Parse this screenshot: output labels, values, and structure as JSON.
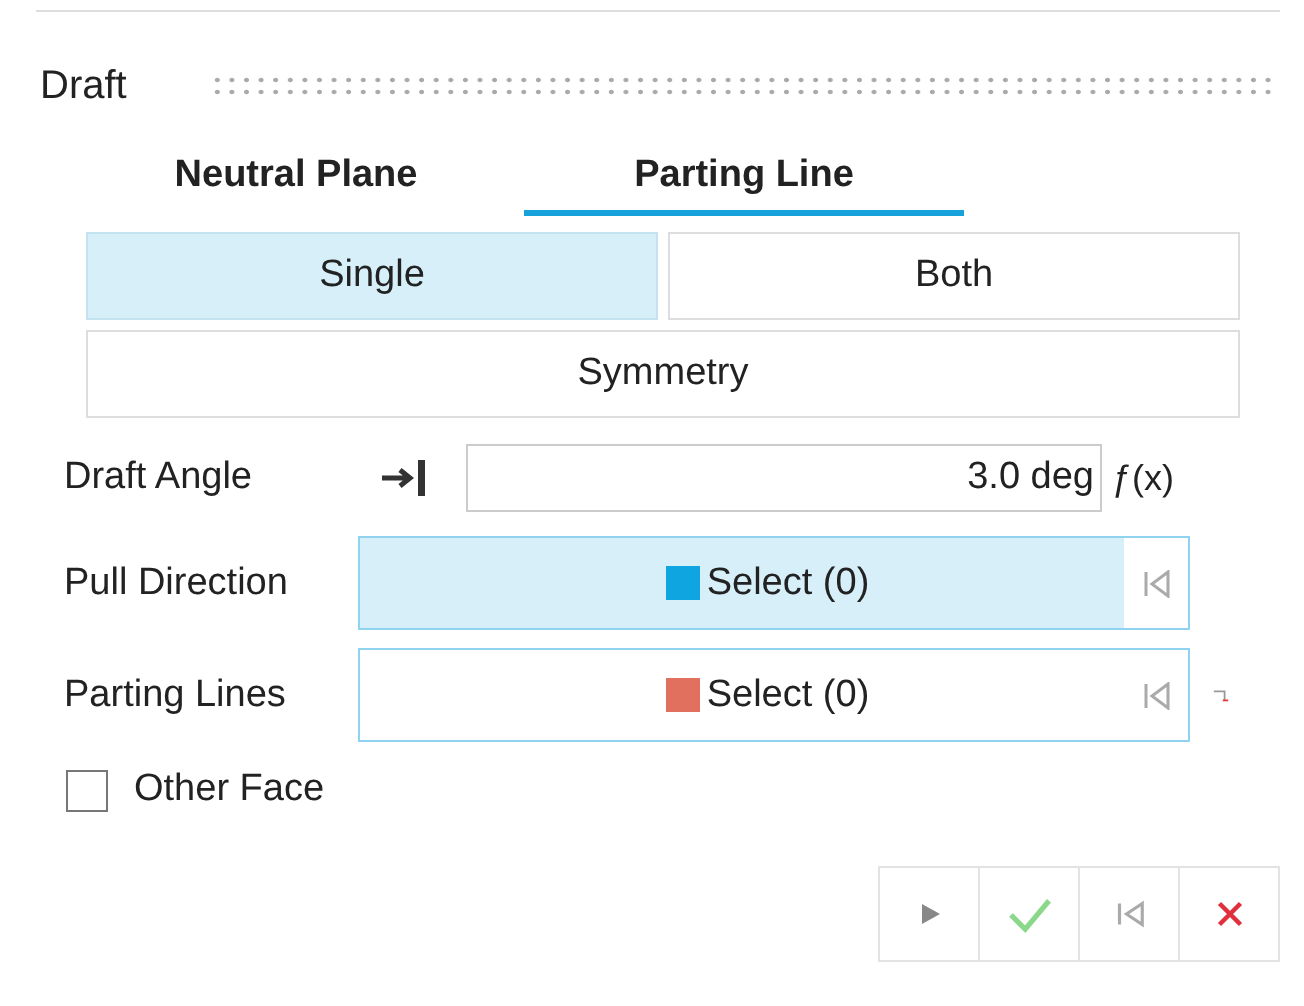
{
  "title": "Draft",
  "tabs": [
    {
      "label": "Neutral Plane",
      "selected": false
    },
    {
      "label": "Parting Line",
      "selected": true
    }
  ],
  "modes": [
    {
      "label": "Single",
      "selected": true
    },
    {
      "label": "Both",
      "selected": false
    },
    {
      "label": "Symmetry",
      "selected": false
    }
  ],
  "draft_angle": {
    "label": "Draft Angle",
    "value": "3.0 deg",
    "function_label": "ƒ(x)"
  },
  "selectors": [
    {
      "label": "Pull Direction",
      "value": "Select (0)",
      "color": "#0ea5e0",
      "active": true,
      "flag": false
    },
    {
      "label": "Parting Lines",
      "value": "Select (0)",
      "color": "#e2705e",
      "active": false,
      "flag": true
    }
  ],
  "other_face": {
    "label": "Other Face",
    "checked": false
  },
  "actions": [
    {
      "kind": "preview"
    },
    {
      "kind": "ok"
    },
    {
      "kind": "reset"
    },
    {
      "kind": "cancel"
    }
  ]
}
